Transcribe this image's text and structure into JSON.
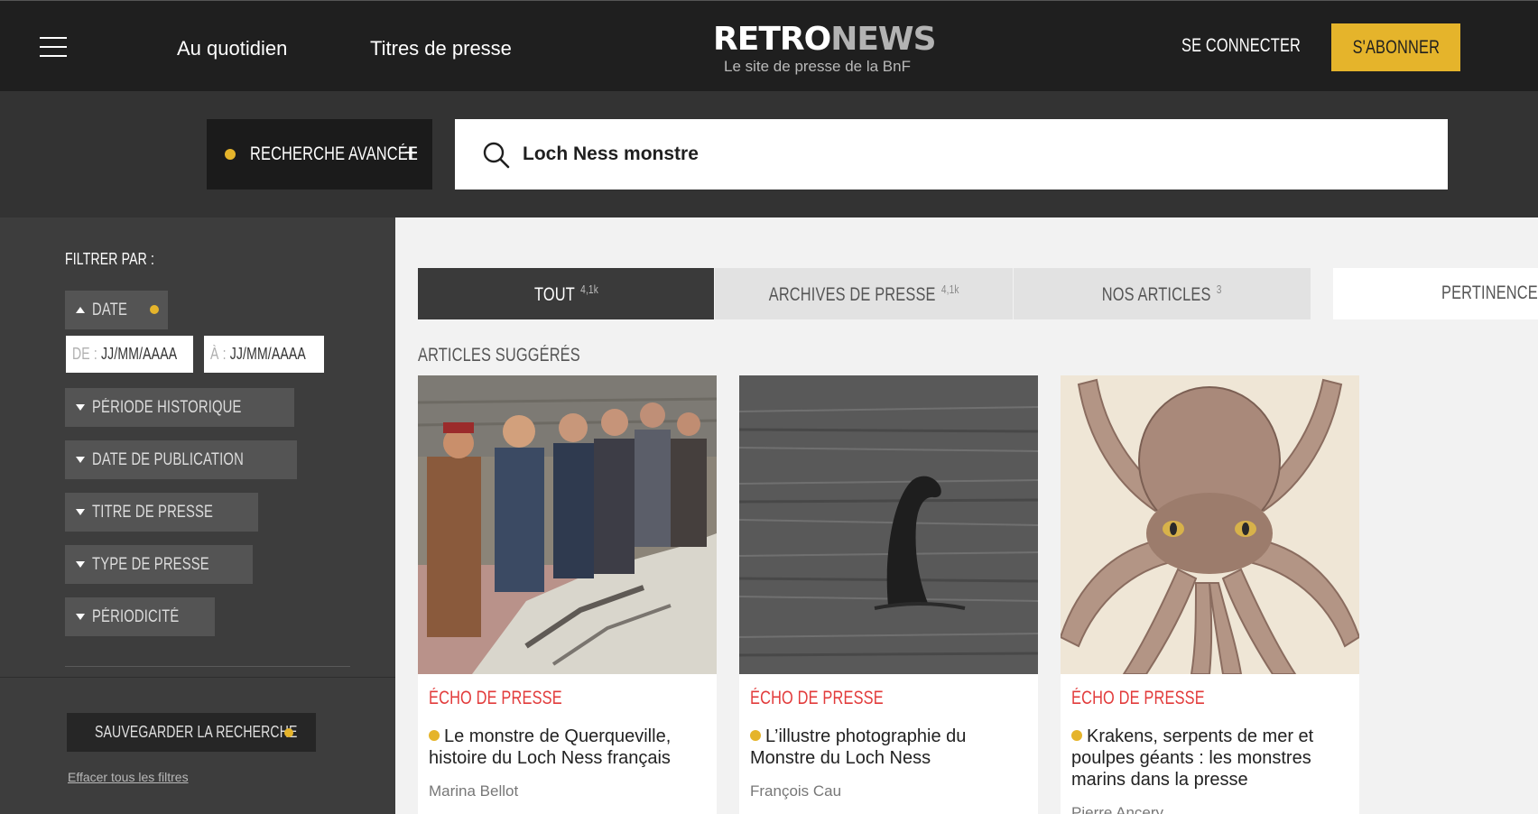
{
  "header": {
    "nav": [
      "Au quotidien",
      "Titres de presse"
    ],
    "logo": {
      "part1": "RETRO",
      "part2": "NEWS"
    },
    "tagline": "Le site de presse de la BnF",
    "login": "SE CONNECTER",
    "subscribe": "S'ABONNER"
  },
  "search": {
    "advanced_label": "RECHERCHE AVANCÉE",
    "advanced_plus": "+",
    "query": "Loch Ness monstre"
  },
  "sidebar": {
    "title": "FILTRER PAR :",
    "date_label": "DATE",
    "from_prefix": "DE :",
    "from_placeholder": "JJ/MM/AAAA",
    "to_prefix": "À :",
    "to_placeholder": "JJ/MM/AAAA",
    "filters": [
      "PÉRIODE HISTORIQUE",
      "DATE DE PUBLICATION",
      "TITRE DE PRESSE",
      "TYPE DE PRESSE",
      "PÉRIODICITÉ"
    ],
    "save": "SAUVEGARDER LA RECHERCHE",
    "clear": "Effacer tous les filtres"
  },
  "tabs": [
    {
      "label": "TOUT",
      "count": "4,1k"
    },
    {
      "label": "ARCHIVES DE PRESSE",
      "count": "4,1k"
    },
    {
      "label": "NOS ARTICLES",
      "count": "3"
    }
  ],
  "sort": "PERTINENCE",
  "suggested_title": "ARTICLES SUGGÉRÉS",
  "cards": [
    {
      "category": "ÉCHO DE PRESSE",
      "title": "Le monstre de Querqueville, histoire du Loch Ness français",
      "author": "Marina Bellot"
    },
    {
      "category": "ÉCHO DE PRESSE",
      "title": "L’illustre photographie du Monstre du Loch Ness",
      "author": "François Cau"
    },
    {
      "category": "ÉCHO DE PRESSE",
      "title": "Krakens, serpents de mer et poulpes géants : les monstres marins dans la presse",
      "author": "Pierre Ancery"
    }
  ],
  "colors": {
    "accent": "#e5b42b",
    "category": "#e23b3b",
    "header": "#1f1f1f",
    "sidebar": "#3d3d3d"
  },
  "icons": [
    "menu-icon",
    "search-icon",
    "plus-icon",
    "caret-up-icon",
    "caret-down-icon"
  ]
}
